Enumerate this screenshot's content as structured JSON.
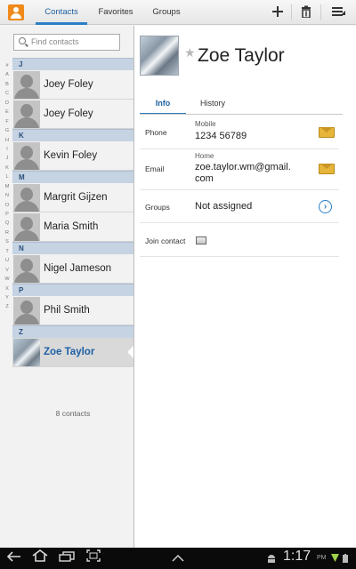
{
  "topbar": {
    "tabs": [
      "Contacts",
      "Favorites",
      "Groups"
    ],
    "active_tab": 0,
    "add_glyph": "+",
    "delete_glyph": "🗑",
    "menu_glyph": "☰"
  },
  "search": {
    "placeholder": "Find contacts"
  },
  "index_letters": [
    "#",
    "A",
    "B",
    "C",
    "D",
    "E",
    "F",
    "G",
    "H",
    "I",
    "J",
    "K",
    "L",
    "M",
    "N",
    "O",
    "P",
    "Q",
    "R",
    "S",
    "T",
    "U",
    "V",
    "W",
    "X",
    "Y",
    "Z"
  ],
  "contact_list": [
    {
      "header": "J",
      "contacts": [
        "Joey Foley",
        "Joey Foley"
      ]
    },
    {
      "header": "K",
      "contacts": [
        "Kevin Foley"
      ]
    },
    {
      "header": "M",
      "contacts": [
        "Margrit Gijzen",
        "Maria Smith"
      ]
    },
    {
      "header": "N",
      "contacts": [
        "Nigel Jameson"
      ]
    },
    {
      "header": "P",
      "contacts": [
        "Phil Smith"
      ]
    },
    {
      "header": "Z",
      "contacts": [
        "Zoe Taylor"
      ]
    }
  ],
  "selected_contact": "Zoe Taylor",
  "contact_count": "8 contacts",
  "detail": {
    "name": "Zoe Taylor",
    "tabs": [
      "Info",
      "History"
    ],
    "phone": {
      "label": "Phone",
      "type": "Mobile",
      "value": "1234 56789"
    },
    "email": {
      "label": "Email",
      "type": "Home",
      "value_line1": "zoe.taylor.wm@gmail.",
      "value_line2": "com"
    },
    "groups": {
      "label": "Groups",
      "value": "Not assigned"
    },
    "join": {
      "label": "Join contact"
    }
  },
  "status_bar": {
    "time": "1:17",
    "ampm": "PM"
  },
  "colors": {
    "accent": "#2b7fc6",
    "section_header": "#c5d3e3",
    "app_icon": "#f08a1c"
  }
}
